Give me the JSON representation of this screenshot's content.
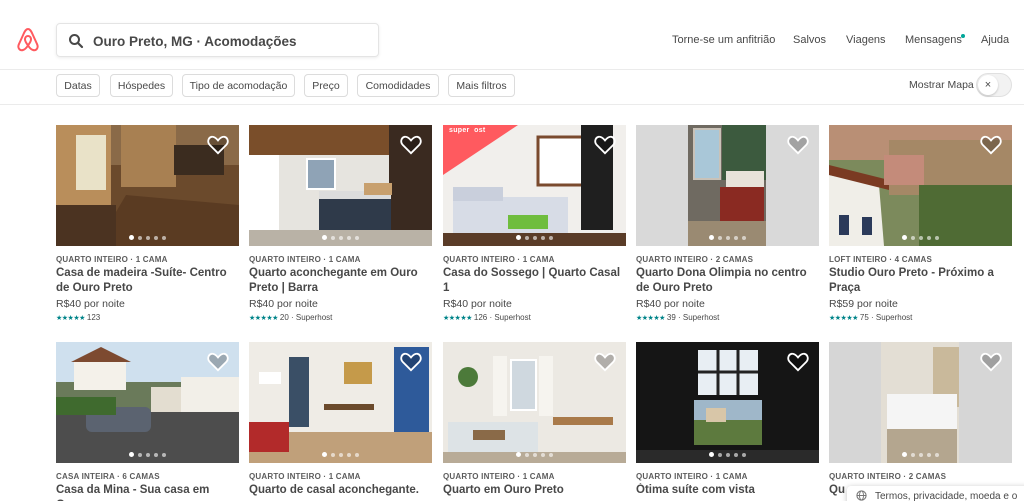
{
  "header": {
    "search_value": "Ouro Preto, MG · Acomodações",
    "nav": [
      "Torne-se um anfitrião",
      "Salvos",
      "Viagens",
      "Mensagens",
      "Ajuda"
    ]
  },
  "filters": {
    "buttons": [
      "Datas",
      "Hóspedes",
      "Tipo de acomodação",
      "Preço",
      "Comodidades",
      "Mais filtros"
    ],
    "map_label": "Mostrar Mapa",
    "map_toggle": "×"
  },
  "listings": [
    {
      "kind": "QUARTO INTEIRO · 1 CAMA",
      "title": "Casa de madeira -Suíte- Centro de Ouro Preto",
      "price": "R$40 por noite",
      "stars": "★★★★★",
      "reviews": "123"
    },
    {
      "kind": "QUARTO INTEIRO · 1 CAMA",
      "title": "Quarto aconchegante em Ouro Preto | Barra",
      "price": "R$40 por noite",
      "stars": "★★★★★",
      "reviews": "20 · Superhost"
    },
    {
      "kind": "QUARTO INTEIRO · 1 CAMA",
      "title": "Casa do Sossego | Quarto Casal 1",
      "price": "R$40 por noite",
      "stars": "★★★★★",
      "reviews": "126 · Superhost",
      "badge": "superhost"
    },
    {
      "kind": "QUARTO INTEIRO · 2 CAMAS",
      "title": "Quarto Dona Olimpia no centro de Ouro Preto",
      "price": "R$40 por noite",
      "stars": "★★★★★",
      "reviews": "39 · Superhost"
    },
    {
      "kind": "LOFT INTEIRO · 4 CAMAS",
      "title": "Studio Ouro Preto - Próximo a Praça",
      "price": "R$59 por noite",
      "stars": "★★★★★",
      "reviews": "75 · Superhost"
    },
    {
      "kind": "CASA INTEIRA · 6 CAMAS",
      "title": "Casa da Mina - Sua casa em Ouro",
      "price": "",
      "stars": "",
      "reviews": ""
    },
    {
      "kind": "QUARTO INTEIRO · 1 CAMA",
      "title": "Quarto de casal aconchegante.",
      "price": "",
      "stars": "",
      "reviews": ""
    },
    {
      "kind": "QUARTO INTEIRO · 1 CAMA",
      "title": "Quarto em Ouro Preto",
      "price": "",
      "stars": "",
      "reviews": ""
    },
    {
      "kind": "QUARTO INTEIRO · 1 CAMA",
      "title": "Ótima suíte com vista",
      "price": "",
      "stars": "",
      "reviews": ""
    },
    {
      "kind": "QUARTO INTEIRO · 2 CAMAS",
      "title": "Qu",
      "price": "",
      "stars": "",
      "reviews": ""
    }
  ],
  "cookie_text": "Termos, privacidade, moeda e o",
  "colors": {
    "brand": "#ff5a5f",
    "rating": "#008489",
    "dot": "#00a699"
  }
}
